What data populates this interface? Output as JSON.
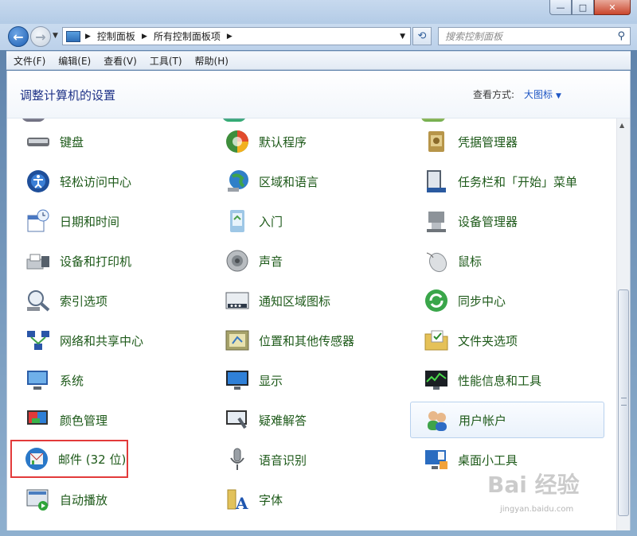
{
  "window": {
    "minimize": "—",
    "maximize": "□",
    "close": "✕"
  },
  "address": {
    "crumbs": [
      "控制面板",
      "所有控制面板项"
    ],
    "search_placeholder": "搜索控制面板"
  },
  "menu": [
    "文件(F)",
    "编辑(E)",
    "查看(V)",
    "工具(T)",
    "帮助(H)"
  ],
  "header": {
    "title": "调整计算机的设置",
    "view_by_label": "查看方式:",
    "view_by_value": "大图标"
  },
  "items": [
    {
      "label": "键盘",
      "icon": "keyboard-icon"
    },
    {
      "label": "默认程序",
      "icon": "default-programs-icon"
    },
    {
      "label": "凭据管理器",
      "icon": "credential-manager-icon"
    },
    {
      "label": "轻松访问中心",
      "icon": "ease-of-access-icon"
    },
    {
      "label": "区域和语言",
      "icon": "region-language-icon"
    },
    {
      "label": "任务栏和「开始」菜单",
      "icon": "taskbar-start-icon"
    },
    {
      "label": "日期和时间",
      "icon": "date-time-icon"
    },
    {
      "label": "入门",
      "icon": "getting-started-icon"
    },
    {
      "label": "设备管理器",
      "icon": "device-manager-icon"
    },
    {
      "label": "设备和打印机",
      "icon": "devices-printers-icon"
    },
    {
      "label": "声音",
      "icon": "sound-icon"
    },
    {
      "label": "鼠标",
      "icon": "mouse-icon"
    },
    {
      "label": "索引选项",
      "icon": "indexing-icon"
    },
    {
      "label": "通知区域图标",
      "icon": "notification-area-icon"
    },
    {
      "label": "同步中心",
      "icon": "sync-center-icon"
    },
    {
      "label": "网络和共享中心",
      "icon": "network-sharing-icon"
    },
    {
      "label": "位置和其他传感器",
      "icon": "location-sensors-icon"
    },
    {
      "label": "文件夹选项",
      "icon": "folder-options-icon"
    },
    {
      "label": "系统",
      "icon": "system-icon"
    },
    {
      "label": "显示",
      "icon": "display-icon"
    },
    {
      "label": "性能信息和工具",
      "icon": "performance-icon"
    },
    {
      "label": "颜色管理",
      "icon": "color-management-icon"
    },
    {
      "label": "疑难解答",
      "icon": "troubleshooting-icon"
    },
    {
      "label": "用户帐户",
      "icon": "user-accounts-icon"
    },
    {
      "label": "邮件 (32 位)",
      "icon": "mail-icon"
    },
    {
      "label": "语音识别",
      "icon": "speech-recognition-icon"
    },
    {
      "label": "桌面小工具",
      "icon": "desktop-gadgets-icon"
    },
    {
      "label": "自动播放",
      "icon": "autoplay-icon"
    },
    {
      "label": "字体",
      "icon": "fonts-icon"
    }
  ],
  "watermark": {
    "text": "Bai 经验",
    "sub": "jingyan.baidu.com"
  }
}
